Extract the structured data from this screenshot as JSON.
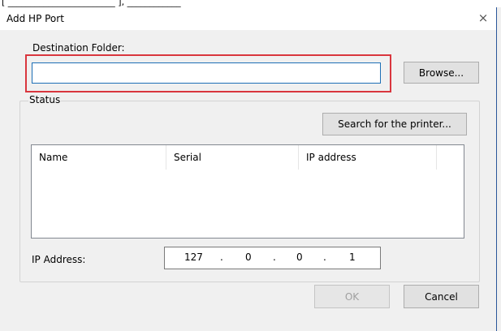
{
  "dialog": {
    "title": "Add HP Port",
    "close_glyph": "×"
  },
  "top_strip_text": "[ ________________________ ], ____________",
  "destination": {
    "label": "Destination Folder:",
    "value": "",
    "browse_label": "Browse..."
  },
  "status": {
    "group_label": "Status",
    "search_label": "Search for the printer...",
    "columns": [
      "Name",
      "Serial",
      "IP address"
    ],
    "rows": []
  },
  "ip": {
    "label": "IP Address:",
    "octets": [
      "127",
      "0",
      "0",
      "1"
    ],
    "separator": "."
  },
  "footer": {
    "ok_label": "OK",
    "cancel_label": "Cancel"
  },
  "colors": {
    "highlight": "#d9363e",
    "input_border": "#1d6fb6",
    "window_border": "#2b579a"
  }
}
